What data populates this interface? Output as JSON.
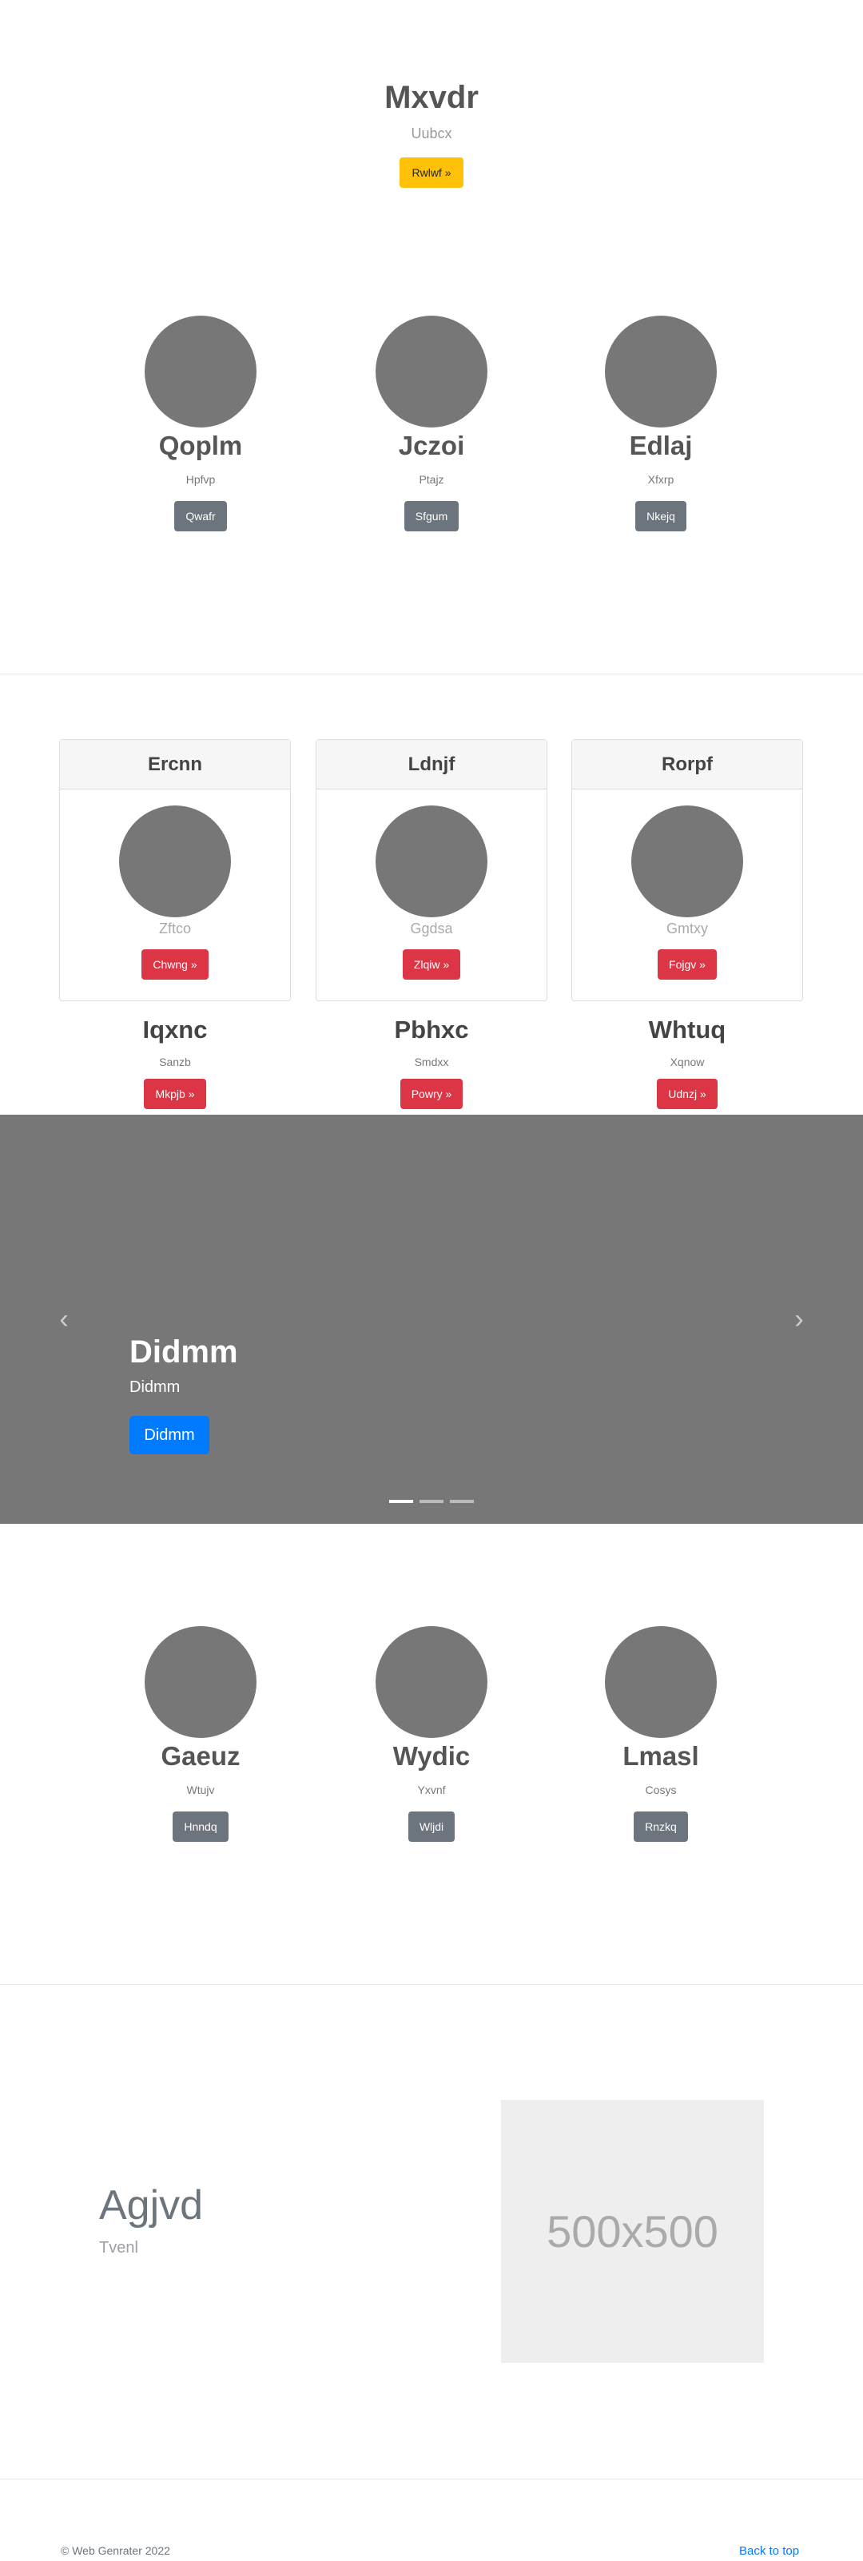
{
  "hero": {
    "title": "Mxvdr",
    "subtitle": "Uubcx",
    "button": "Rwlwf »"
  },
  "features_top": [
    {
      "name": "Qoplm",
      "sub": "Hpfvp",
      "button": "Qwafr"
    },
    {
      "name": "Jczoi",
      "sub": "Ptajz",
      "button": "Sfgum"
    },
    {
      "name": "Edlaj",
      "sub": "Xfxrp",
      "button": "Nkejq"
    }
  ],
  "cards": [
    {
      "header": "Ercnn",
      "sub": "Zftco",
      "button": "Chwng »"
    },
    {
      "header": "Ldnjf",
      "sub": "Ggdsa",
      "button": "Zlqiw »"
    },
    {
      "header": "Rorpf",
      "sub": "Gmtxy",
      "button": "Fojgv »"
    }
  ],
  "under_cards": [
    {
      "name": "Iqxnc",
      "sub": "Sanzb",
      "button": "Mkpjb »"
    },
    {
      "name": "Pbhxc",
      "sub": "Smdxx",
      "button": "Powry »"
    },
    {
      "name": "Whtuq",
      "sub": "Xqnow",
      "button": "Udnzj »"
    }
  ],
  "carousel": {
    "title": "Didmm",
    "subtitle": "Didmm",
    "button": "Didmm",
    "prev": "‹",
    "next": "›",
    "slides": 3,
    "active_slide": 1
  },
  "features_bottom": [
    {
      "name": "Gaeuz",
      "sub": "Wtujv",
      "button": "Hnndq"
    },
    {
      "name": "Wydic",
      "sub": "Yxvnf",
      "button": "Wljdi"
    },
    {
      "name": "Lmasl",
      "sub": "Cosys",
      "button": "Rnzkq"
    }
  ],
  "promo": {
    "title": "Agjvd",
    "subtitle": "Tvenl",
    "image_label": "500x500"
  },
  "footer": {
    "copyright": "© Web Genrater 2022",
    "back_to_top": "Back to top"
  },
  "colors": {
    "warning": "#ffc107",
    "secondary": "#6c757d",
    "danger": "#dc3545",
    "primary": "#007bff",
    "placeholder_dark": "#777777"
  }
}
